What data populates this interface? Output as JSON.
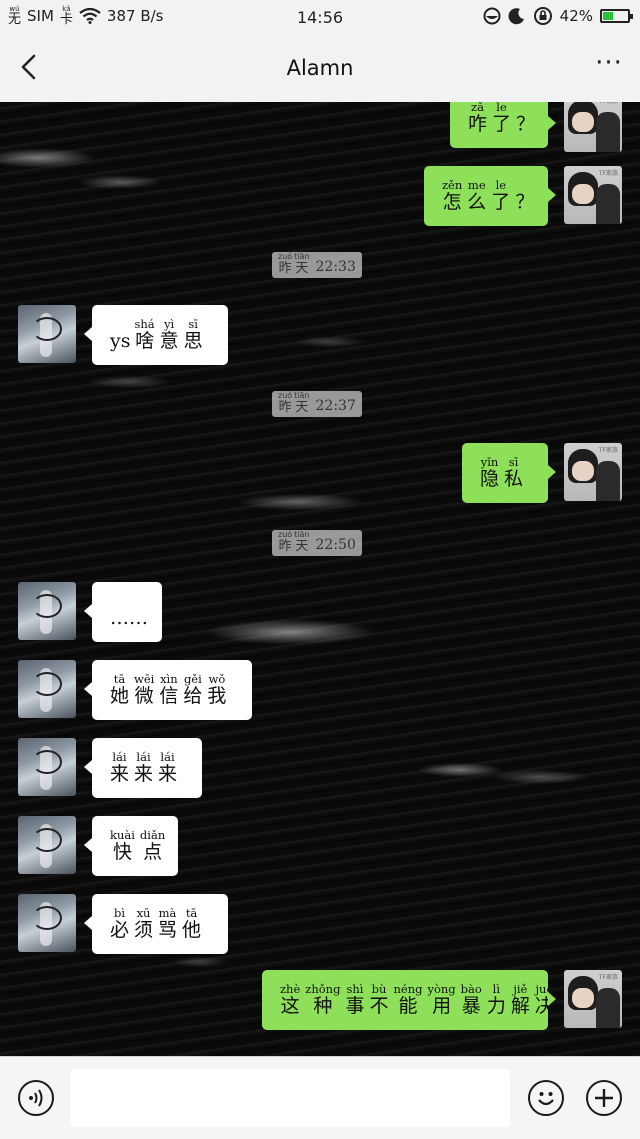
{
  "status": {
    "sim_pinyin": [
      "wú",
      "kǎ"
    ],
    "sim_chars": [
      "无",
      "卡"
    ],
    "sim_label": "SIM",
    "speed": "387 B/s",
    "time": "14:56",
    "battery": "42%",
    "battery_level": 0.42
  },
  "nav": {
    "title": "Alamn",
    "more": "···"
  },
  "messages": [
    {
      "side": "out",
      "words": [
        {
          "p": "zǎ",
          "c": "咋"
        },
        {
          "p": "le",
          "c": "了"
        },
        {
          "p": "",
          "c": "？"
        }
      ]
    },
    {
      "side": "out",
      "words": [
        {
          "p": "zěn",
          "c": "怎"
        },
        {
          "p": "me",
          "c": "么"
        },
        {
          "p": "le",
          "c": "了"
        },
        {
          "p": "",
          "c": "？"
        }
      ]
    },
    {
      "side": "stamp",
      "words": [
        {
          "p": "zuó",
          "c": "昨"
        },
        {
          "p": "tiān",
          "c": "天"
        }
      ],
      "time": "22:33"
    },
    {
      "side": "in",
      "prefix": "ys",
      "words": [
        {
          "p": "shá",
          "c": "啥"
        },
        {
          "p": "yì",
          "c": "意"
        },
        {
          "p": "sī",
          "c": "思"
        }
      ]
    },
    {
      "side": "stamp",
      "words": [
        {
          "p": "zuó",
          "c": "昨"
        },
        {
          "p": "tiān",
          "c": "天"
        }
      ],
      "time": "22:37"
    },
    {
      "side": "out",
      "words": [
        {
          "p": "yǐn",
          "c": "隐"
        },
        {
          "p": "sī",
          "c": "私"
        }
      ]
    },
    {
      "side": "stamp",
      "words": [
        {
          "p": "zuó",
          "c": "昨"
        },
        {
          "p": "tiān",
          "c": "天"
        }
      ],
      "time": "22:50"
    },
    {
      "side": "in",
      "prefix": "……",
      "words": []
    },
    {
      "side": "in",
      "words": [
        {
          "p": "tā",
          "c": "她"
        },
        {
          "p": "wēi",
          "c": "微"
        },
        {
          "p": "xìn",
          "c": "信"
        },
        {
          "p": "gěi",
          "c": "给"
        },
        {
          "p": "wǒ",
          "c": "我"
        }
      ]
    },
    {
      "side": "in",
      "words": [
        {
          "p": "lái",
          "c": "来"
        },
        {
          "p": "lái",
          "c": "来"
        },
        {
          "p": "lái",
          "c": "来"
        }
      ]
    },
    {
      "side": "in",
      "words": [
        {
          "p": "kuài",
          "c": "快"
        },
        {
          "p": "diǎn",
          "c": "点"
        }
      ]
    },
    {
      "side": "in",
      "words": [
        {
          "p": "bì",
          "c": "必"
        },
        {
          "p": "xū",
          "c": "须"
        },
        {
          "p": "mà",
          "c": "骂"
        },
        {
          "p": "tā",
          "c": "他"
        }
      ]
    },
    {
      "side": "out",
      "words": [
        {
          "p": "zhè",
          "c": "这"
        },
        {
          "p": "zhǒng",
          "c": "种"
        },
        {
          "p": "shì",
          "c": "事"
        },
        {
          "p": "bù",
          "c": "不"
        },
        {
          "p": "néng",
          "c": "能"
        },
        {
          "p": "yòng",
          "c": "用"
        },
        {
          "p": "bào",
          "c": "暴"
        },
        {
          "p": "lì",
          "c": "力"
        },
        {
          "p": "jiě",
          "c": "解"
        },
        {
          "p": "jué",
          "c": "决"
        }
      ]
    }
  ],
  "avatar_tag": "TF家族",
  "colors": {
    "out_bubble": "#8ee05a",
    "in_bubble": "#ffffff",
    "bar_bg": "#f2f2f2"
  },
  "icons": {
    "back": "chevron-left-icon",
    "more": "more-dots-icon",
    "voice": "voice-icon",
    "emoji": "emoji-icon",
    "plus": "plus-icon"
  }
}
